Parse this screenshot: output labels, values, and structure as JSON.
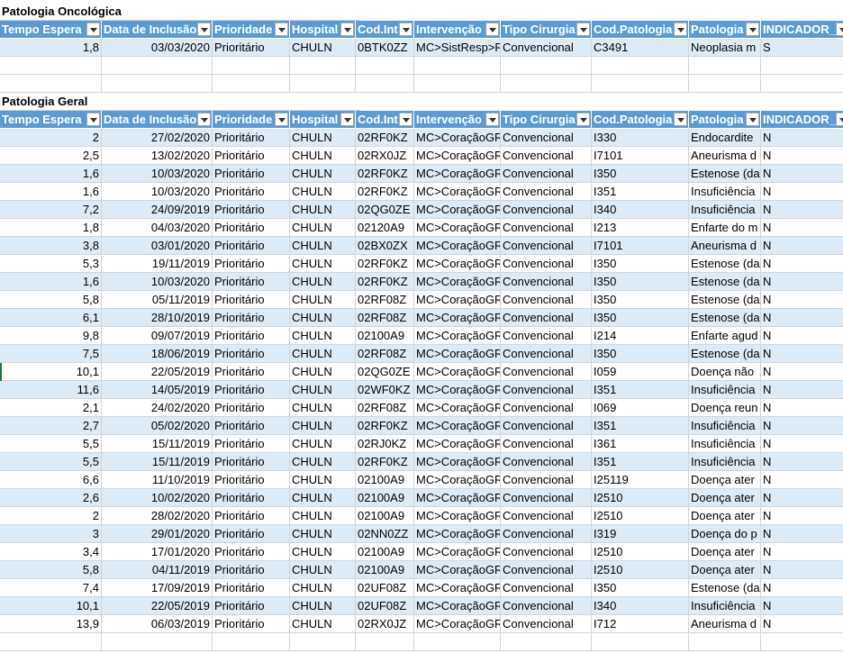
{
  "sections": [
    {
      "title": "Patologia Oncológica",
      "headers": [
        "Tempo Espera",
        "Data de Inclusão",
        "Prioridade",
        "Hospital",
        "Cod.Int",
        "Intervenção",
        "Tipo Cirurgia",
        "Cod.Patologia",
        "Patologia",
        "INDICADOR_C"
      ],
      "rows": [
        [
          "1,8",
          "03/03/2020",
          "Prioritário",
          "CHULN",
          "0BTK0ZZ",
          "MC>SistResp>R",
          "Convencional",
          "C3491",
          "Neoplasia m",
          "S"
        ]
      ]
    },
    {
      "title": "Patologia Geral",
      "headers": [
        "Tempo Espera",
        "Data de Inclusão",
        "Prioridade",
        "Hospital",
        "Cod.Int",
        "Intervenção",
        "Tipo Cirurgia",
        "Cod.Patologia",
        "Patologia",
        "INDICADOR_C"
      ],
      "rows": [
        [
          "2",
          "27/02/2020",
          "Prioritário",
          "CHULN",
          "02RF0KZ",
          "MC>CoraçãoGR",
          "Convencional",
          "I330",
          "Endocardite",
          "N"
        ],
        [
          "2,5",
          "13/02/2020",
          "Prioritário",
          "CHULN",
          "02RX0JZ",
          "MC>CoraçãoGR",
          "Convencional",
          "I7101",
          "Aneurisma d",
          "N"
        ],
        [
          "1,6",
          "10/03/2020",
          "Prioritário",
          "CHULN",
          "02RF0KZ",
          "MC>CoraçãoGR",
          "Convencional",
          "I350",
          "Estenose (da",
          "N"
        ],
        [
          "1,6",
          "10/03/2020",
          "Prioritário",
          "CHULN",
          "02RF0KZ",
          "MC>CoraçãoGR",
          "Convencional",
          "I351",
          "Insuficiência",
          "N"
        ],
        [
          "7,2",
          "24/09/2019",
          "Prioritário",
          "CHULN",
          "02QG0ZE",
          "MC>CoraçãoGR",
          "Convencional",
          "I340",
          "Insuficiência",
          "N"
        ],
        [
          "1,8",
          "04/03/2020",
          "Prioritário",
          "CHULN",
          "02120A9",
          "MC>CoraçãoGR",
          "Convencional",
          "I213",
          "Enfarte do m",
          "N"
        ],
        [
          "3,8",
          "03/01/2020",
          "Prioritário",
          "CHULN",
          "02BX0ZX",
          "MC>CoraçãoGR",
          "Convencional",
          "I7101",
          "Aneurisma d",
          "N"
        ],
        [
          "5,3",
          "19/11/2019",
          "Prioritário",
          "CHULN",
          "02RF0KZ",
          "MC>CoraçãoGR",
          "Convencional",
          "I350",
          "Estenose (da",
          "N"
        ],
        [
          "1,6",
          "10/03/2020",
          "Prioritário",
          "CHULN",
          "02RF0KZ",
          "MC>CoraçãoGR",
          "Convencional",
          "I350",
          "Estenose (da",
          "N"
        ],
        [
          "5,8",
          "05/11/2019",
          "Prioritário",
          "CHULN",
          "02RF08Z",
          "MC>CoraçãoGR",
          "Convencional",
          "I350",
          "Estenose (da",
          "N"
        ],
        [
          "6,1",
          "28/10/2019",
          "Prioritário",
          "CHULN",
          "02RF08Z",
          "MC>CoraçãoGR",
          "Convencional",
          "I350",
          "Estenose (da",
          "N"
        ],
        [
          "9,8",
          "09/07/2019",
          "Prioritário",
          "CHULN",
          "02100A9",
          "MC>CoraçãoGR",
          "Convencional",
          "I214",
          "Enfarte agud",
          "N"
        ],
        [
          "7,5",
          "18/06/2019",
          "Prioritário",
          "CHULN",
          "02RF08Z",
          "MC>CoraçãoGR",
          "Convencional",
          "I350",
          "Estenose (da",
          "N"
        ],
        [
          "10,1",
          "22/05/2019",
          "Prioritário",
          "CHULN",
          "02QG0ZE",
          "MC>CoraçãoGR",
          "Convencional",
          "I059",
          "Doença não",
          "N"
        ],
        [
          "11,6",
          "14/05/2019",
          "Prioritário",
          "CHULN",
          "02WF0KZ",
          "MC>CoraçãoGR",
          "Convencional",
          "I351",
          "Insuficiência",
          "N"
        ],
        [
          "2,1",
          "24/02/2020",
          "Prioritário",
          "CHULN",
          "02RF08Z",
          "MC>CoraçãoGR",
          "Convencional",
          "I069",
          "Doença reun",
          "N"
        ],
        [
          "2,7",
          "05/02/2020",
          "Prioritário",
          "CHULN",
          "02RF0KZ",
          "MC>CoraçãoGR",
          "Convencional",
          "I351",
          "Insuficiência",
          "N"
        ],
        [
          "5,5",
          "15/11/2019",
          "Prioritário",
          "CHULN",
          "02RJ0KZ",
          "MC>CoraçãoGR",
          "Convencional",
          "I361",
          "Insuficiência",
          "N"
        ],
        [
          "5,5",
          "15/11/2019",
          "Prioritário",
          "CHULN",
          "02RF0KZ",
          "MC>CoraçãoGR",
          "Convencional",
          "I351",
          "Insuficiência",
          "N"
        ],
        [
          "6,6",
          "11/10/2019",
          "Prioritário",
          "CHULN",
          "02100A9",
          "MC>CoraçãoGR",
          "Convencional",
          "I25119",
          "Doença ater",
          "N"
        ],
        [
          "2,6",
          "10/02/2020",
          "Prioritário",
          "CHULN",
          "02100A9",
          "MC>CoraçãoGR",
          "Convencional",
          "I2510",
          "Doença ater",
          "N"
        ],
        [
          "2",
          "28/02/2020",
          "Prioritário",
          "CHULN",
          "02100A9",
          "MC>CoraçãoGR",
          "Convencional",
          "I2510",
          "Doença ater",
          "N"
        ],
        [
          "3",
          "29/01/2020",
          "Prioritário",
          "CHULN",
          "02NN0ZZ",
          "MC>CoraçãoGR",
          "Convencional",
          "I319",
          "Doença do p",
          "N"
        ],
        [
          "3,4",
          "17/01/2020",
          "Prioritário",
          "CHULN",
          "02100A9",
          "MC>CoraçãoGR",
          "Convencional",
          "I2510",
          "Doença ater",
          "N"
        ],
        [
          "5,8",
          "04/11/2019",
          "Prioritário",
          "CHULN",
          "02100A9",
          "MC>CoraçãoGR",
          "Convencional",
          "I2510",
          "Doença ater",
          "N"
        ],
        [
          "7,4",
          "17/09/2019",
          "Prioritário",
          "CHULN",
          "02UF08Z",
          "MC>CoraçãoGR",
          "Convencional",
          "I350",
          "Estenose (da",
          "N"
        ],
        [
          "10,1",
          "22/05/2019",
          "Prioritário",
          "CHULN",
          "02UF08Z",
          "MC>CoraçãoGR",
          "Convencional",
          "I340",
          "Insuficiência",
          "N"
        ],
        [
          "13,9",
          "06/03/2019",
          "Prioritário",
          "CHULN",
          "02RX0JZ",
          "MC>CoraçãoGR",
          "Convencional",
          "I712",
          "Aneurisma d",
          "N"
        ]
      ]
    }
  ],
  "colors": {
    "header_bg": "#5b9bd5",
    "band_bg": "#ddebf7",
    "grid": "#d4d4d4",
    "selection": "#217346"
  },
  "icons": {
    "header_filter": "filter-dropdown-icon"
  }
}
